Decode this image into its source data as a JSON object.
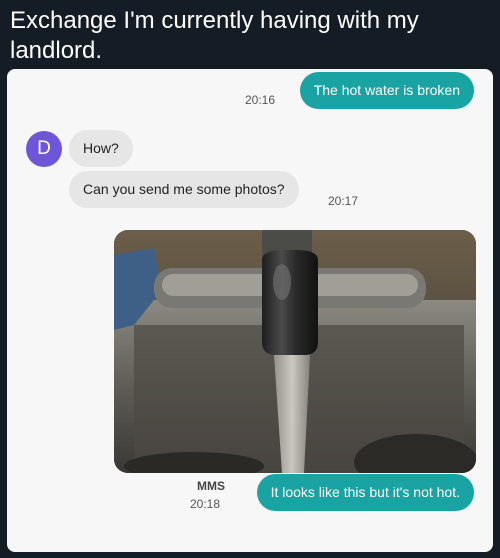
{
  "post": {
    "title": "Exchange I'm currently having with my landlord."
  },
  "conversation": {
    "contact_initial": "D",
    "messages": [
      {
        "direction": "outgoing",
        "text": "The hot water is broken",
        "time": "20:16"
      },
      {
        "direction": "incoming",
        "text": "How?"
      },
      {
        "direction": "incoming",
        "text": "Can you send me some photos?",
        "time": "20:17"
      },
      {
        "direction": "outgoing",
        "type": "photo",
        "photo_icon": "running-faucet-photo"
      },
      {
        "direction": "outgoing",
        "text": "It looks like this but it's not hot.",
        "label": "MMS",
        "time": "20:18"
      }
    ]
  },
  "colors": {
    "outgoing_bubble": "#1aa3a3",
    "incoming_bubble": "#e6e6e6",
    "avatar": "#6f55d8",
    "page_background": "#141d26"
  }
}
